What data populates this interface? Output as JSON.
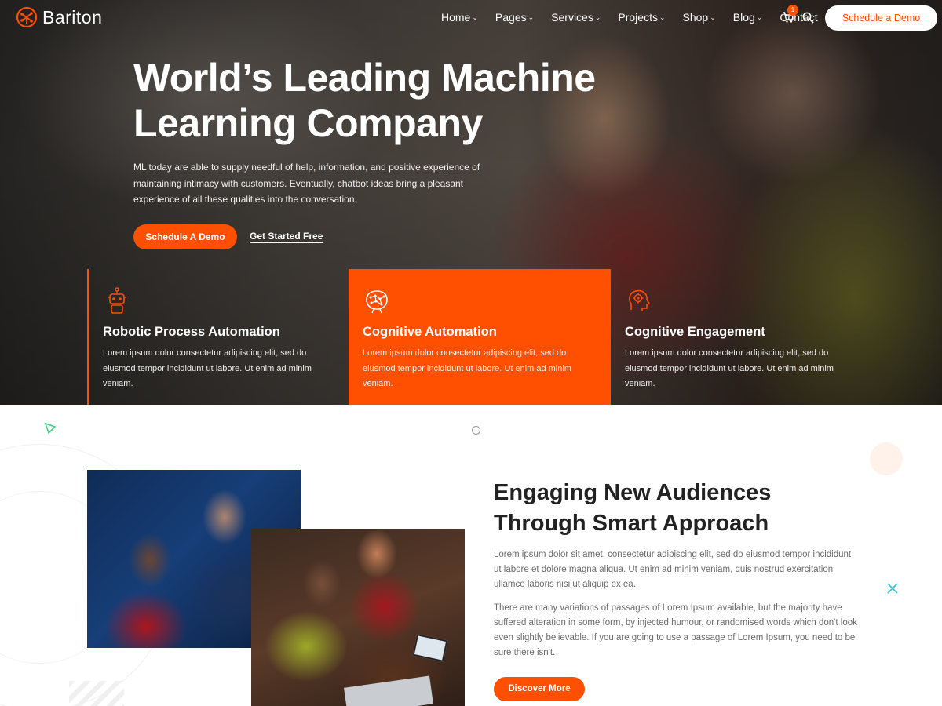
{
  "brand": {
    "name": "Bariton",
    "accent": "#ff4f00"
  },
  "header": {
    "nav": [
      {
        "label": "Home",
        "dropdown": true
      },
      {
        "label": "Pages",
        "dropdown": true
      },
      {
        "label": "Services",
        "dropdown": true
      },
      {
        "label": "Projects",
        "dropdown": true
      },
      {
        "label": "Shop",
        "dropdown": true
      },
      {
        "label": "Blog",
        "dropdown": true
      },
      {
        "label": "Contact",
        "dropdown": false
      }
    ],
    "cart_count": "1",
    "cart_icon": "cart-icon",
    "search_icon": "search-icon",
    "cta_label": "Schedule a Demo"
  },
  "hero": {
    "title": "World’s Leading Machine Learning Company",
    "description": "ML today are able to supply needful of help, information, and positive experience of maintaining intimacy with customers. Eventually, chatbot ideas bring a pleasant experience of all these qualities into the conversation.",
    "primary_button": "Schedule A Demo",
    "secondary_link": "Get Started Free"
  },
  "features": [
    {
      "icon": "robot-icon",
      "title": "Robotic Process Automation",
      "text": "Lorem ipsum dolor consectetur adipiscing elit, sed do eiusmod tempor incididunt ut labore. Ut enim ad minim veniam."
    },
    {
      "icon": "brain-icon",
      "title": "Cognitive Automation",
      "text": "Lorem ipsum dolor consectetur adipiscing elit, sed do eiusmod tempor incididunt ut labore. Ut enim ad minim veniam."
    },
    {
      "icon": "head-gear-icon",
      "title": "Cognitive Engagement",
      "text": "Lorem ipsum dolor consectetur adipiscing elit, sed do eiusmod tempor incididunt ut labore. Ut enim ad minim veniam."
    }
  ],
  "about": {
    "title": "Engaging New Audiences Through Smart Approach",
    "paragraph1": "Lorem ipsum dolor sit amet, consectetur adipiscing elit, sed do eiusmod tempor incididunt ut labore et dolore magna aliqua. Ut enim ad minim veniam, quis nostrud exercitation ullamco laboris nisi ut aliquip ex ea.",
    "paragraph2": "There are many variations of passages of Lorem Ipsum available, but the majority have suffered alteration in some form, by injected humour, or randomised words which don't look even slightly believable. If you are going to use a passage of Lorem Ipsum, you need to be sure there isn't.",
    "button": "Discover More"
  }
}
